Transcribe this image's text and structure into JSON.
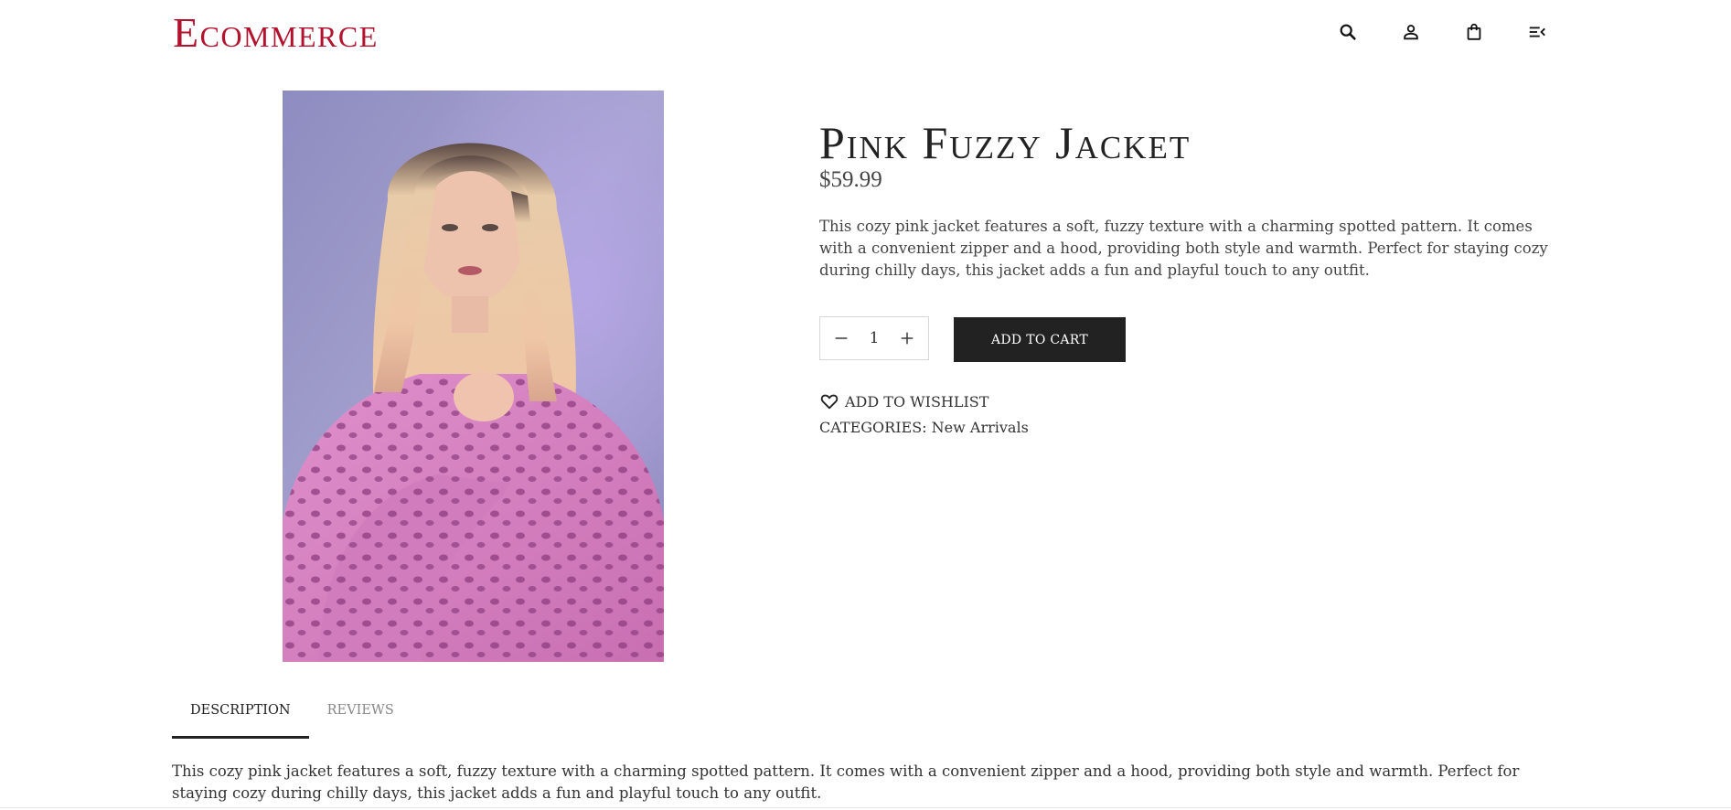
{
  "brand": {
    "name": "Ecommerce",
    "color": "#b3122e"
  },
  "header": {
    "icons": [
      "search-icon",
      "user-icon",
      "shopping-bag-icon",
      "menu-icon"
    ]
  },
  "product": {
    "title": "Pink Fuzzy Jacket",
    "price": "$59.99",
    "description": "This cozy pink jacket features a soft, fuzzy texture with a charming spotted pattern. It comes with a convenient zipper and a hood, providing both style and warmth. Perfect for staying cozy during chilly days, this jacket adds a fun and playful touch to any outfit.",
    "quantity": "1",
    "add_to_cart_label": "ADD TO CART",
    "wishlist_label": "ADD TO WISHLIST",
    "categories_label": "CATEGORIES:",
    "category": "New Arrivals"
  },
  "tabs": [
    {
      "label": "DESCRIPTION",
      "active": true
    },
    {
      "label": "REVIEWS",
      "active": false
    }
  ],
  "tab_content": {
    "description": "This cozy pink jacket features a soft, fuzzy texture with a charming spotted pattern. It comes with a convenient zipper and a hood, providing both style and warmth. Perfect for staying cozy during chilly days, this jacket adds a fun and playful touch to any outfit."
  },
  "colors": {
    "button_bg": "#222222",
    "button_text": "#ffffff",
    "jacket_pink": "#d77fc0",
    "background_lavender": "#9a96c4"
  }
}
